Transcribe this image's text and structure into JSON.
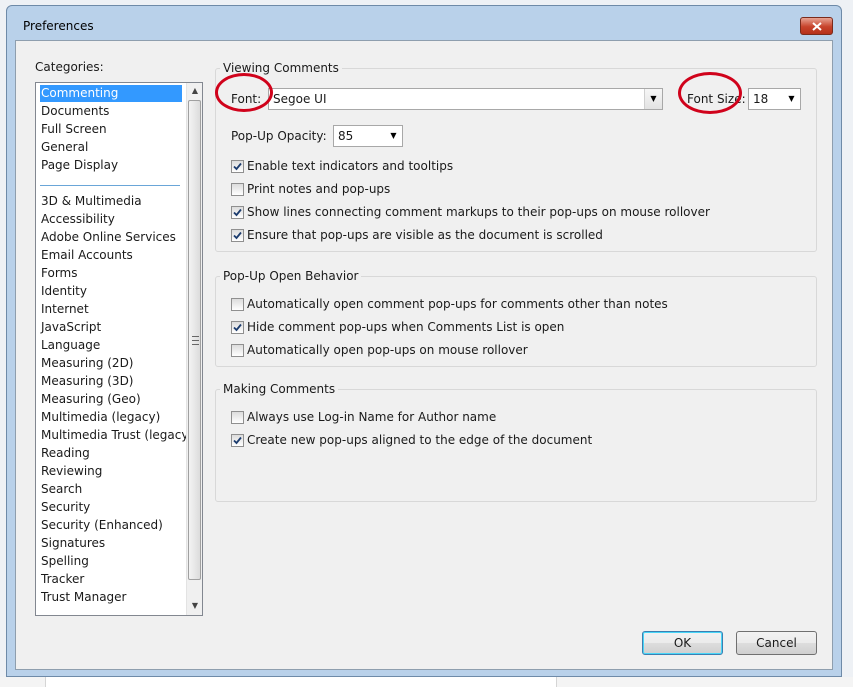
{
  "window": {
    "title": "Preferences"
  },
  "categories": {
    "label": "Categories:",
    "group1": [
      "Commenting",
      "Documents",
      "Full Screen",
      "General",
      "Page Display"
    ],
    "group2": [
      "3D & Multimedia",
      "Accessibility",
      "Adobe Online Services",
      "Email Accounts",
      "Forms",
      "Identity",
      "Internet",
      "JavaScript",
      "Language",
      "Measuring (2D)",
      "Measuring (3D)",
      "Measuring (Geo)",
      "Multimedia (legacy)",
      "Multimedia Trust (legacy)",
      "Reading",
      "Reviewing",
      "Search",
      "Security",
      "Security (Enhanced)",
      "Signatures",
      "Spelling",
      "Tracker",
      "Trust Manager"
    ],
    "selected": "Commenting"
  },
  "viewing_comments": {
    "title": "Viewing Comments",
    "font_label": "Font:",
    "font_value": "Segoe UI",
    "font_size_label": "Font Size:",
    "font_size_value": "18",
    "opacity_label": "Pop-Up Opacity:",
    "opacity_value": "85",
    "checkboxes": [
      {
        "label": "Enable text indicators and tooltips",
        "checked": true
      },
      {
        "label": "Print notes and pop-ups",
        "checked": false
      },
      {
        "label": "Show lines connecting comment markups to their pop-ups on mouse rollover",
        "checked": true
      },
      {
        "label": "Ensure that pop-ups are visible as the document is scrolled",
        "checked": true
      }
    ]
  },
  "popup_behavior": {
    "title": "Pop-Up Open Behavior",
    "checkboxes": [
      {
        "label": "Automatically open comment pop-ups for comments other than notes",
        "checked": false
      },
      {
        "label": "Hide comment pop-ups when Comments List is open",
        "checked": true
      },
      {
        "label": "Automatically open pop-ups on mouse rollover",
        "checked": false
      }
    ]
  },
  "making_comments": {
    "title": "Making Comments",
    "checkboxes": [
      {
        "label": "Always use Log-in Name for Author name",
        "checked": false
      },
      {
        "label": "Create new pop-ups aligned to the edge of the document",
        "checked": true
      }
    ]
  },
  "buttons": {
    "ok": "OK",
    "cancel": "Cancel"
  },
  "colors": {
    "selection": "#3399ff",
    "annotation": "#d0021b",
    "frame": "#b9d1ea"
  }
}
